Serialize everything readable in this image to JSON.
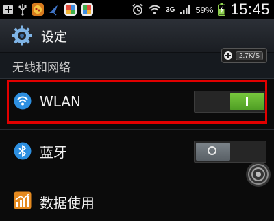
{
  "status_bar": {
    "network_type": "3G",
    "battery_percent": "59%",
    "time": "15:45",
    "left_icons": [
      "add-icon",
      "usb-icon",
      "app-icon",
      "bird-icon",
      "app-icon",
      "app-icon"
    ],
    "right_icons": [
      "alarm-icon",
      "wifi-icon",
      "signal-icon",
      "battery-icon"
    ]
  },
  "header": {
    "title": "设定",
    "icon": "gear-icon"
  },
  "section": {
    "title": "无线和网络",
    "speed_badge": "2.7K/S"
  },
  "settings": [
    {
      "label": "WLAN",
      "icon": "wifi-icon",
      "toggle": "on"
    },
    {
      "label": "蓝牙",
      "icon": "bluetooth-icon",
      "toggle": "off"
    },
    {
      "label": "数据使用",
      "icon": "chart-icon"
    }
  ],
  "colors": {
    "toggle_on": "#5cb32c",
    "highlight": "#e10000",
    "wifi_blue": "#2d8fe0"
  }
}
